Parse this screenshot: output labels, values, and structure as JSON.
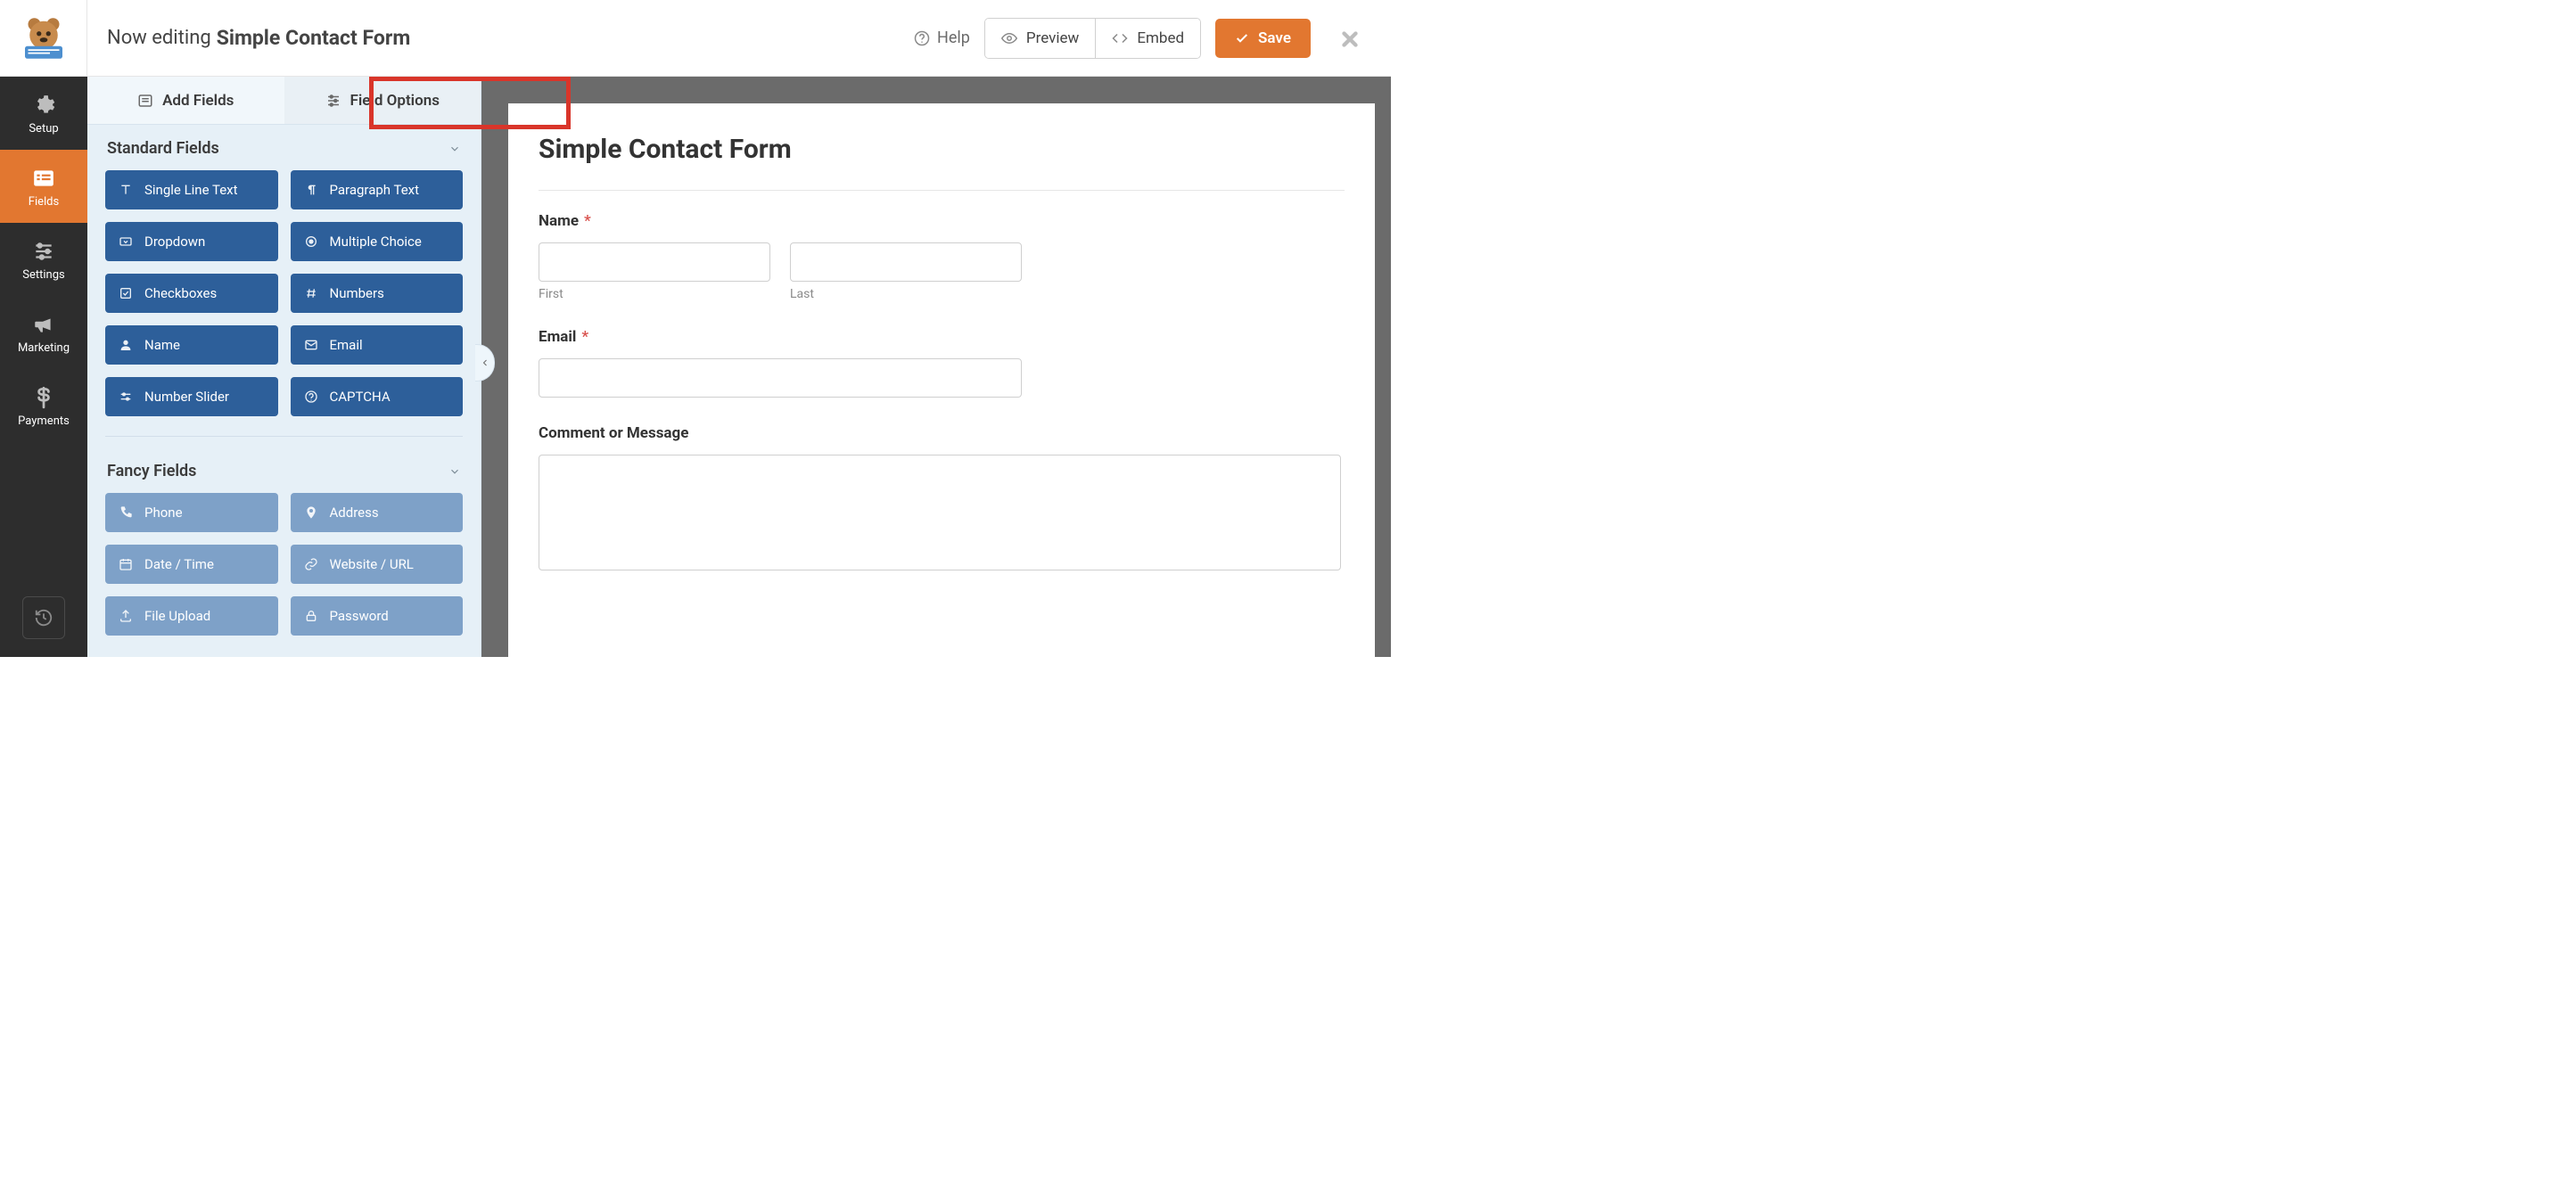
{
  "topbar": {
    "editing_prefix": "Now editing",
    "form_name": "Simple Contact Form",
    "help_label": "Help",
    "preview_label": "Preview",
    "embed_label": "Embed",
    "save_label": "Save"
  },
  "rail": {
    "items": [
      {
        "label": "Setup",
        "icon": "gear"
      },
      {
        "label": "Fields",
        "icon": "list"
      },
      {
        "label": "Settings",
        "icon": "sliders"
      },
      {
        "label": "Marketing",
        "icon": "bullhorn"
      },
      {
        "label": "Payments",
        "icon": "dollar"
      }
    ]
  },
  "panel": {
    "tabs": {
      "add_fields": "Add Fields",
      "field_options": "Field Options"
    },
    "groups": {
      "standard_title": "Standard Fields",
      "fancy_title": "Fancy Fields"
    },
    "standard": [
      {
        "icon": "text",
        "label": "Single Line Text"
      },
      {
        "icon": "paragraph",
        "label": "Paragraph Text"
      },
      {
        "icon": "select",
        "label": "Dropdown"
      },
      {
        "icon": "radio",
        "label": "Multiple Choice"
      },
      {
        "icon": "check",
        "label": "Checkboxes"
      },
      {
        "icon": "hash",
        "label": "Numbers"
      },
      {
        "icon": "user",
        "label": "Name"
      },
      {
        "icon": "mail",
        "label": "Email"
      },
      {
        "icon": "slider",
        "label": "Number Slider"
      },
      {
        "icon": "help",
        "label": "CAPTCHA"
      }
    ],
    "fancy": [
      {
        "icon": "phone",
        "label": "Phone"
      },
      {
        "icon": "pin",
        "label": "Address"
      },
      {
        "icon": "calendar",
        "label": "Date / Time"
      },
      {
        "icon": "link",
        "label": "Website / URL"
      },
      {
        "icon": "upload",
        "label": "File Upload"
      },
      {
        "icon": "lock",
        "label": "Password"
      }
    ]
  },
  "canvas": {
    "title": "Simple Contact Form",
    "name_label": "Name",
    "first_sublabel": "First",
    "last_sublabel": "Last",
    "email_label": "Email",
    "message_label": "Comment or Message"
  }
}
